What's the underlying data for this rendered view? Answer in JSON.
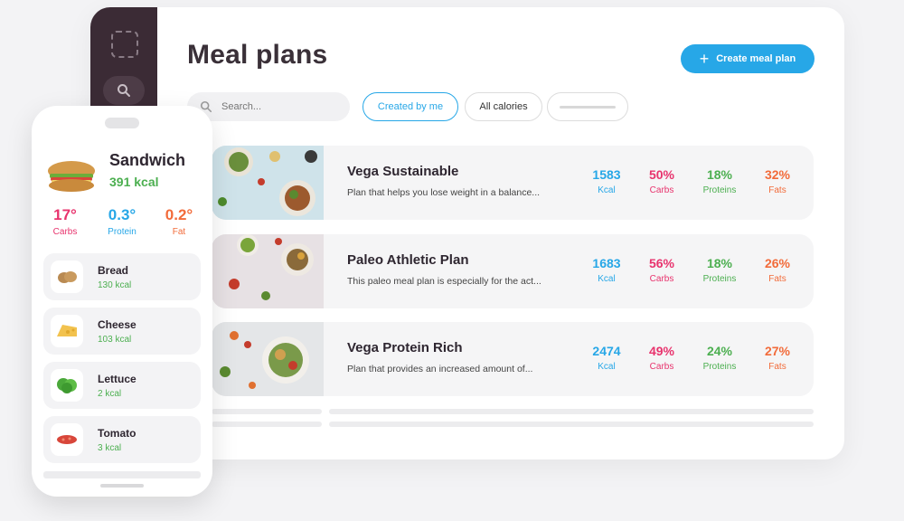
{
  "header": {
    "title": "Meal plans",
    "create_label": "Create meal plan"
  },
  "search": {
    "placeholder": "Search..."
  },
  "filters": {
    "created_by_me": "Created by me",
    "all_calories": "All calories"
  },
  "colors": {
    "accent": "#27a7e7",
    "kcal": "#27a7e7",
    "carbs": "#e8336d",
    "proteins": "#4caf50",
    "fats": "#f26b3a",
    "sidebar": "#3b2b35"
  },
  "plans": [
    {
      "name": "Vega Sustainable",
      "desc": "Plan that helps you lose weight in a balance...",
      "kcal": "1583",
      "kcal_label": "Kcal",
      "carbs": "50%",
      "carbs_label": "Carbs",
      "proteins": "18%",
      "proteins_label": "Proteins",
      "fats": "32%",
      "fats_label": "Fats"
    },
    {
      "name": "Paleo Athletic Plan",
      "desc": "This paleo meal plan is especially for the act...",
      "kcal": "1683",
      "kcal_label": "Kcal",
      "carbs": "56%",
      "carbs_label": "Carbs",
      "proteins": "18%",
      "proteins_label": "Proteins",
      "fats": "26%",
      "fats_label": "Fats"
    },
    {
      "name": "Vega Protein Rich",
      "desc": "Plan that provides an increased amount of...",
      "kcal": "2474",
      "kcal_label": "Kcal",
      "carbs": "49%",
      "carbs_label": "Carbs",
      "proteins": "24%",
      "proteins_label": "Proteins",
      "fats": "27%",
      "fats_label": "Fats"
    }
  ],
  "phone": {
    "title": "Sandwich",
    "kcal": "391 kcal",
    "macros": [
      {
        "value": "17°",
        "label": "Carbs"
      },
      {
        "value": "0.3°",
        "label": "Protein"
      },
      {
        "value": "0.2°",
        "label": "Fat"
      }
    ],
    "ingredients": [
      {
        "name": "Bread",
        "kcal": "130 kcal",
        "icon": "bread-icon"
      },
      {
        "name": "Cheese",
        "kcal": "103 kcal",
        "icon": "cheese-icon"
      },
      {
        "name": "Lettuce",
        "kcal": "2 kcal",
        "icon": "lettuce-icon"
      },
      {
        "name": "Tomato",
        "kcal": "3 kcal",
        "icon": "tomato-icon"
      }
    ]
  }
}
